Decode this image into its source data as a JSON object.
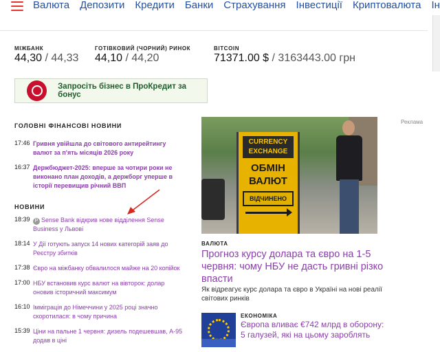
{
  "nav": {
    "items": [
      "Валюта",
      "Депозити",
      "Кредити",
      "Банки",
      "Страхування",
      "Інвестиції",
      "Криптовалюта",
      "Інд"
    ]
  },
  "rates": [
    {
      "label": "МІЖБАНК",
      "buy": "44,30",
      "sep": " / ",
      "sell": "44,33"
    },
    {
      "label": "ГОТІВКОВИЙ (ЧОРНИЙ) РИНОК",
      "buy": "44,10",
      "sep": " / ",
      "sell": "44,20"
    },
    {
      "label": "BITCOIN",
      "buy": "71371.00 $",
      "sep": " / ",
      "sell": "3163443.00 грн"
    }
  ],
  "banner": {
    "text": "Запросіть бізнес в ПроКредит за бонус"
  },
  "main_news": {
    "title": "ГОЛОВНІ ФІНАНСОВІ НОВИНИ",
    "items": [
      {
        "time": "17:46",
        "title": "Гривня увійшла до світового антирейтингу валют за п'ять місяців 2026 року"
      },
      {
        "time": "16:37",
        "title": "Держбюджет-2025: вперше за чотири роки не виконано план доходів, а держборг уперше в історії перевищив річний ВВП"
      }
    ]
  },
  "news": {
    "title": "НОВИНИ",
    "sponsor_mark": "P",
    "items": [
      {
        "time": "18:39",
        "title": "Sense Bank відкрив нове відділення Sense Business у Львові",
        "sponsored": true
      },
      {
        "time": "18:14",
        "title": "У Дії готують запуск 14 нових категорій заяв до Реєстру збитків"
      },
      {
        "time": "17:38",
        "title": "Євро на міжбанку обвалилося майже на 20 копійок"
      },
      {
        "time": "17:00",
        "title": "НБУ встановив курс валют на вівторок: долар оновив історичний максимум"
      },
      {
        "time": "16:10",
        "title": "Імміграція до Німеччини у 2025 році значно скоротилася: в чому причина"
      },
      {
        "time": "15:39",
        "title": "Ціни на пальне 1 червня: дизель подешевшав, А-95 додав в ціні"
      }
    ]
  },
  "ad_label": "Реклама",
  "photo_sign": {
    "top": "CURRENCY EXCHANGE",
    "big": "ОБМІН ВАЛЮТ",
    "status": "ВІДЧИНЕНО"
  },
  "feature": {
    "category": "ВАЛЮТА",
    "headline": "Прогноз курсу долара та євро на 1-5 червня: чому НБУ не дасть гривні різко впасти",
    "lead": "Як відреагує курс долара та євро в Україні на нові реалії світових ринків"
  },
  "feature2": {
    "category": "ЕКОНОМІКА",
    "headline": "Європа вливає €742 млрд в оборону: 5 галузей, які на цьому зароблять"
  },
  "colors": {
    "nav_link": "#2450a0",
    "news_link": "#8a3daa",
    "accent": "#e8332a"
  }
}
